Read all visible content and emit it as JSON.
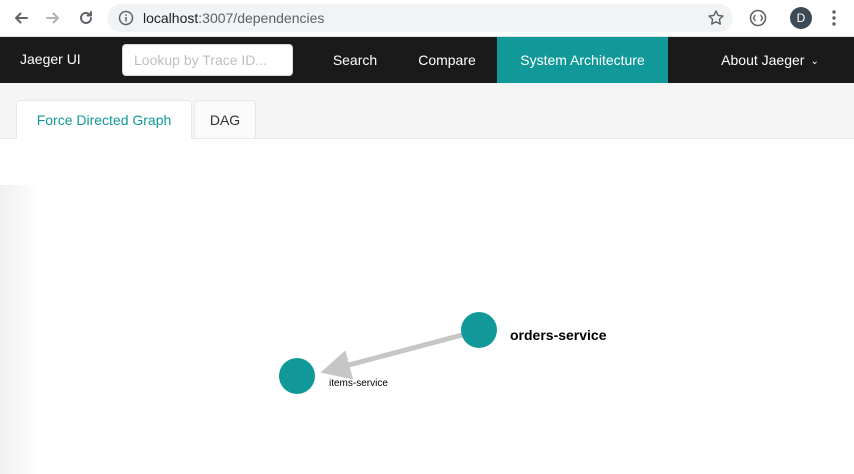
{
  "browser": {
    "url_host": "localhost",
    "url_port_path": ":3007/dependencies",
    "profile_initial": "D",
    "icons": [
      "back-icon",
      "forward-icon",
      "reload-icon",
      "info-icon",
      "star-icon",
      "extension-icon",
      "kebab-menu-icon"
    ]
  },
  "topnav": {
    "brand": "Jaeger UI",
    "lookup_placeholder": "Lookup by Trace ID...",
    "search": "Search",
    "compare": "Compare",
    "system_architecture": "System Architecture",
    "about": "About Jaeger",
    "accent_color": "#119999"
  },
  "tabs": {
    "force": "Force Directed Graph",
    "dag": "DAG",
    "active": "Force Directed Graph"
  },
  "graph": {
    "node_color": "#119999",
    "edge_color": "#c6c6c6",
    "nodes": [
      {
        "id": "orders-service",
        "label": "orders-service"
      },
      {
        "id": "items-service",
        "label": "items-service"
      }
    ],
    "edges": [
      {
        "from": "orders-service",
        "to": "items-service"
      }
    ]
  }
}
